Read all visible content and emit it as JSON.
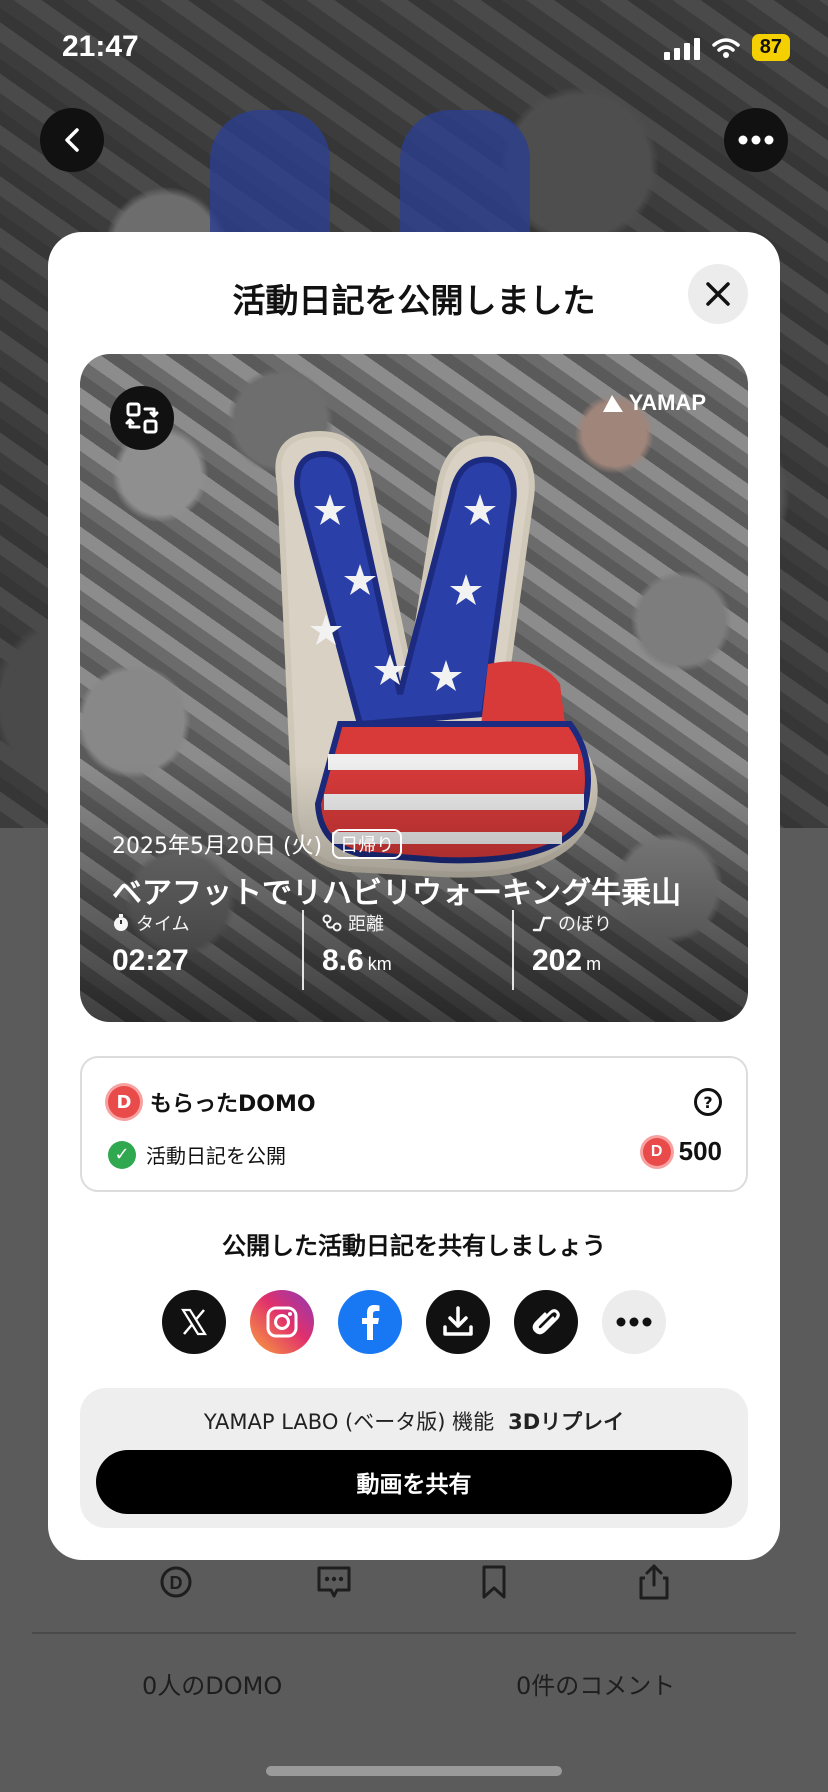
{
  "status_bar": {
    "time": "21:47",
    "battery": "87"
  },
  "modal": {
    "title": "活動日記を公開しました",
    "card": {
      "logo_text": "YAMAP",
      "date": "2025年5月20日 (火)",
      "trip_type": "日帰り",
      "activity_title": "ベアフットでリハビリウォーキング牛乗山",
      "stats": [
        {
          "label": "タイム",
          "value": "02:27",
          "unit": ""
        },
        {
          "label": "距離",
          "value": "8.6",
          "unit": "km"
        },
        {
          "label": "のぼり",
          "value": "202",
          "unit": "m"
        }
      ]
    },
    "domo": {
      "heading": "もらったDOMO",
      "item_label": "活動日記を公開",
      "points": "500",
      "help": "?"
    },
    "share": {
      "heading": "公開した活動日記を共有しましょう",
      "buttons": [
        "x-icon",
        "instagram-icon",
        "facebook-icon",
        "download-icon",
        "link-icon",
        "more-icon"
      ]
    },
    "labo": {
      "label": "YAMAP LABO (ベータ版) 機能",
      "feature": "3Dリプレイ",
      "button": "動画を共有"
    }
  },
  "background": {
    "domo_count": "0人のDOMO",
    "comment_count": "0件のコメント"
  },
  "colors": {
    "accent_black": "#000000",
    "domo_red": "#e94a4a",
    "check_green": "#2fa84f",
    "facebook_blue": "#1877f2",
    "battery_yellow": "#f5d000"
  }
}
